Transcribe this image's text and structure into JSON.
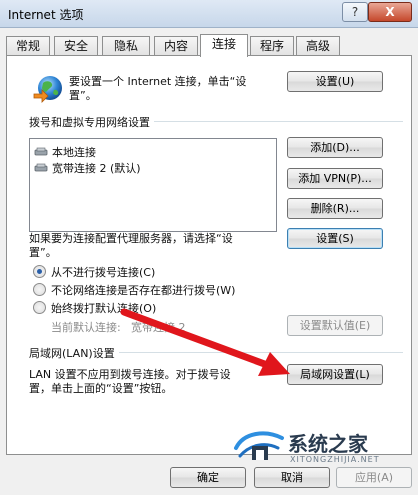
{
  "window": {
    "title": "Internet 选项",
    "help_label": "?",
    "close_label": "X"
  },
  "tabs": [
    {
      "label": "常规"
    },
    {
      "label": "安全"
    },
    {
      "label": "隐私"
    },
    {
      "label": "内容"
    },
    {
      "label": "连接"
    },
    {
      "label": "程序"
    },
    {
      "label": "高级"
    }
  ],
  "setup": {
    "line1": "要设置一个 Internet 连接，单击“设",
    "line2": "置”。",
    "button": "设置(U)"
  },
  "dialup": {
    "group_title": "拨号和虚拟专用网络设置",
    "items": [
      {
        "label": "本地连接"
      },
      {
        "label": "宽带连接 2 (默认)"
      }
    ],
    "add_button": "添加(D)...",
    "add_vpn_button": "添加 VPN(P)...",
    "delete_button": "删除(R)...",
    "proxy_line1": "如果要为连接配置代理服务器，请选择“设",
    "proxy_line2": "置”。",
    "settings_button": "设置(S)",
    "options": [
      {
        "label": "从不进行拨号连接(C)",
        "checked": true
      },
      {
        "label": "不论网络连接是否存在都进行拨号(W)",
        "checked": false
      },
      {
        "label": "始终拨打默认连接(O)",
        "checked": false
      }
    ],
    "current_default_label": "当前默认连接:",
    "current_default_value": "宽带连接 2",
    "set_default_button": "设置默认值(E)"
  },
  "lan": {
    "group_title": "局域网(LAN)设置",
    "line1": "LAN 设置不应用到拨号连接。对于拨号设",
    "line2": "置，单击上面的“设置”按钮。",
    "button": "局域网设置(L)"
  },
  "footer": {
    "ok_button": "确定",
    "cancel_button": "取消",
    "apply_button": "应用(A)"
  },
  "watermark": {
    "text": "系统之家",
    "sub": "XITONGZHIJIA.NET"
  },
  "colors": {
    "accent": "#3c7fb1",
    "arrow": "#e0161c"
  }
}
